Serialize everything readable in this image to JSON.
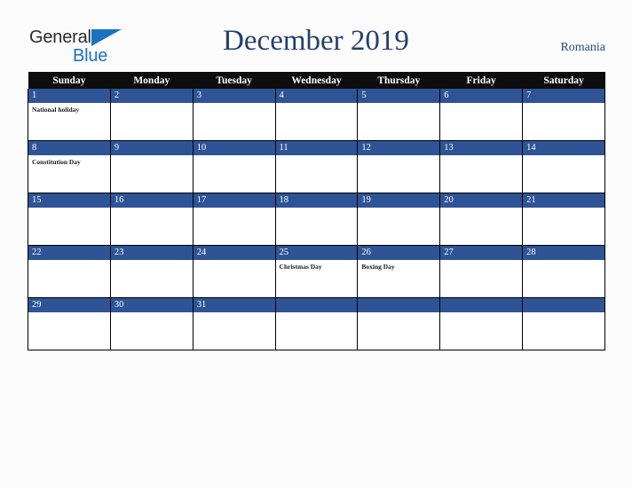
{
  "brand": {
    "name_part1": "General",
    "name_part2": "Blue",
    "triangle_icon": "triangle-icon",
    "accent_color": "#1b72c0",
    "text_color": "#2b2b2b"
  },
  "header": {
    "title": "December 2019",
    "country": "Romania",
    "title_color": "#26406b",
    "country_color": "#2d4a77"
  },
  "calendar": {
    "header_bg": "#0d0d0d",
    "daynum_bg": "#2e5496",
    "cell_bg": "#ffffff",
    "border_color": "#000000",
    "weekday_headers": [
      "Sunday",
      "Monday",
      "Tuesday",
      "Wednesday",
      "Thursday",
      "Friday",
      "Saturday"
    ],
    "weeks": [
      [
        {
          "day": "1",
          "events": [
            "National holiday"
          ]
        },
        {
          "day": "2",
          "events": []
        },
        {
          "day": "3",
          "events": []
        },
        {
          "day": "4",
          "events": []
        },
        {
          "day": "5",
          "events": []
        },
        {
          "day": "6",
          "events": []
        },
        {
          "day": "7",
          "events": []
        }
      ],
      [
        {
          "day": "8",
          "events": [
            "Constitution Day"
          ]
        },
        {
          "day": "9",
          "events": []
        },
        {
          "day": "10",
          "events": []
        },
        {
          "day": "11",
          "events": []
        },
        {
          "day": "12",
          "events": []
        },
        {
          "day": "13",
          "events": []
        },
        {
          "day": "14",
          "events": []
        }
      ],
      [
        {
          "day": "15",
          "events": []
        },
        {
          "day": "16",
          "events": []
        },
        {
          "day": "17",
          "events": []
        },
        {
          "day": "18",
          "events": []
        },
        {
          "day": "19",
          "events": []
        },
        {
          "day": "20",
          "events": []
        },
        {
          "day": "21",
          "events": []
        }
      ],
      [
        {
          "day": "22",
          "events": []
        },
        {
          "day": "23",
          "events": []
        },
        {
          "day": "24",
          "events": []
        },
        {
          "day": "25",
          "events": [
            "Christmas Day"
          ]
        },
        {
          "day": "26",
          "events": [
            "Boxing Day"
          ]
        },
        {
          "day": "27",
          "events": []
        },
        {
          "day": "28",
          "events": []
        }
      ],
      [
        {
          "day": "29",
          "events": []
        },
        {
          "day": "30",
          "events": []
        },
        {
          "day": "31",
          "events": []
        },
        {
          "day": "",
          "events": []
        },
        {
          "day": "",
          "events": []
        },
        {
          "day": "",
          "events": []
        },
        {
          "day": "",
          "events": []
        }
      ]
    ]
  }
}
